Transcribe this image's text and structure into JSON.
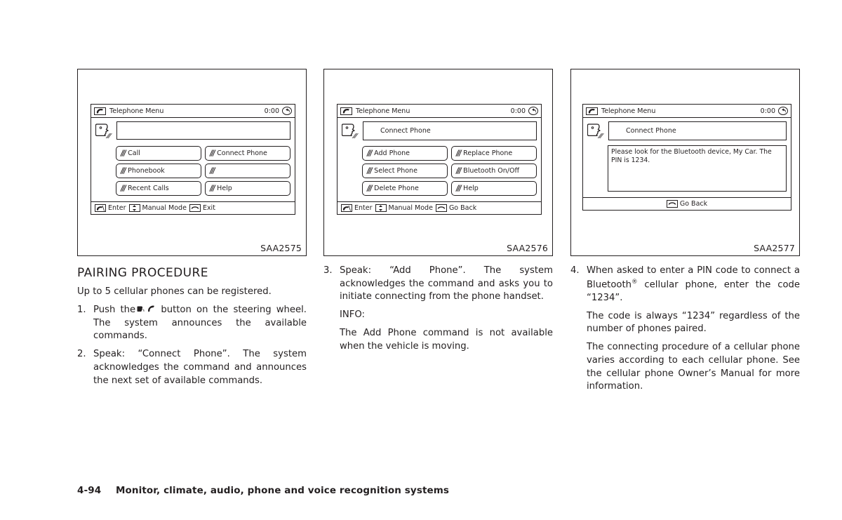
{
  "figures": [
    {
      "id": "fig-telephone-menu",
      "caption": "SAA2575",
      "screen": {
        "title": "Telephone Menu",
        "clock": "0:00",
        "prompt": "",
        "buttons": [
          "Call",
          "Connect Phone",
          "Phonebook",
          "",
          "Recent Calls",
          "Help"
        ],
        "footer": [
          "Enter",
          "Manual Mode",
          "Exit"
        ]
      }
    },
    {
      "id": "fig-connect-phone-menu",
      "caption": "SAA2576",
      "screen": {
        "title": "Telephone Menu",
        "clock": "0:00",
        "prompt": "Connect Phone",
        "buttons": [
          "Add Phone",
          "Replace Phone",
          "Select Phone",
          "Bluetooth On/Off",
          "Delete Phone",
          "Help"
        ],
        "footer": [
          "Enter",
          "Manual Mode",
          "Go Back"
        ]
      }
    },
    {
      "id": "fig-pin-message",
      "caption": "SAA2577",
      "screen": {
        "title": "Telephone Menu",
        "clock": "0:00",
        "prompt": "Connect Phone",
        "message": "Please look for the Bluetooth device, My Car. The PIN is 1234.",
        "footer": [
          "Go Back"
        ]
      }
    }
  ],
  "column1": {
    "section_title": "PAIRING PROCEDURE",
    "lead": "Up to 5 cellular phones can be registered.",
    "step1_num": "1.",
    "step1_part_a": "Push the",
    "step1_part_b": "button on the steering wheel. The system announces the available commands.",
    "step2_num": "2.",
    "step2_text": "Speak: “Connect Phone”. The system acknowledges the command and announces the next set of available commands."
  },
  "column2": {
    "step3_num": "3.",
    "step3_text": "Speak: “Add Phone”. The system acknowledges the command and asks you to initiate connecting from the phone handset.",
    "info_label": "INFO:",
    "info_text": "The Add Phone command is not available when the vehicle is moving."
  },
  "column3": {
    "step4_num": "4.",
    "step4_part_a": "When asked to enter a PIN code to connect a Bluetooth",
    "step4_sup": "®",
    "step4_part_b": " cellular phone, enter the code “1234”.",
    "para2": "The code is always “1234” regardless of the number of phones paired.",
    "para3": "The connecting procedure of a cellular phone varies according to each cellular phone. See the cellular phone Owner’s Manual for more information."
  },
  "page_footer": {
    "page_number": "4-94",
    "chapter_title": "Monitor, climate, audio, phone and voice recognition systems"
  }
}
